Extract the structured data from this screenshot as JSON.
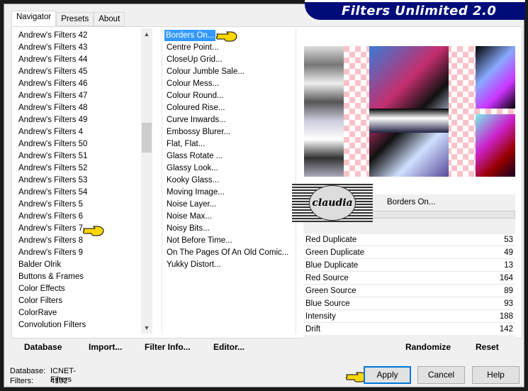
{
  "title": "Filters Unlimited 2.0",
  "tabs": [
    "Navigator",
    "Presets",
    "About"
  ],
  "categories": [
    "Andrew's Filters 42",
    "Andrew's Filters 43",
    "Andrew's Filters 44",
    "Andrew's Filters 45",
    "Andrew's Filters 46",
    "Andrew's Filters 47",
    "Andrew's Filters 48",
    "Andrew's Filters 49",
    "Andrew's Filters 4",
    "Andrew's Filters 50",
    "Andrew's Filters 51",
    "Andrew's Filters 52",
    "Andrew's Filters 53",
    "Andrew's Filters 54",
    "Andrew's Filters 5",
    "Andrew's Filters 6",
    "Andrew's Filters 7",
    "Andrew's Filters 8",
    "Andrew's Filters 9",
    "Balder Olrik",
    "Buttons & Frames",
    "Color Effects",
    "Color Filters",
    "ColorRave",
    "Convolution Filters"
  ],
  "selected_category": "Andrew's Filters 7",
  "filters": [
    "Borders On...",
    "Centre Point...",
    "CloseUp Grid...",
    "Colour Jumble Sale...",
    "Colour Mess...",
    "Colour Round...",
    "Coloured Rise...",
    "Curve Inwards...",
    "Embossy Blurer...",
    "Flat, Flat...",
    "Glass Rotate ...",
    "Glassy Look...",
    "Kooky Glass...",
    "Moving Image...",
    "Noise Layer...",
    "Noise Max...",
    "Noisy Bits...",
    "Not Before Time...",
    "On The Pages Of An Old Comic...",
    "Yukky Distort..."
  ],
  "selected_filter": "Borders On...",
  "filter_name": "Borders On...",
  "watermark": "claudia",
  "params": [
    {
      "label": "Red Duplicate",
      "value": 53
    },
    {
      "label": "Green Duplicate",
      "value": 49
    },
    {
      "label": "Blue Duplicate",
      "value": 13
    },
    {
      "label": "Red Source",
      "value": 164
    },
    {
      "label": "Green Source",
      "value": 89
    },
    {
      "label": "Blue Source",
      "value": 93
    },
    {
      "label": "Intensity",
      "value": 188
    },
    {
      "label": "Drift",
      "value": 142
    }
  ],
  "buttons": {
    "database": "Database",
    "import": "Import...",
    "filter_info": "Filter Info...",
    "editor": "Editor...",
    "randomize": "Randomize",
    "reset": "Reset",
    "apply": "Apply",
    "cancel": "Cancel",
    "help": "Help"
  },
  "status": {
    "database_label": "Database:",
    "database_value": "ICNET-Filters",
    "filters_label": "Filters:",
    "filters_value": "4102"
  }
}
